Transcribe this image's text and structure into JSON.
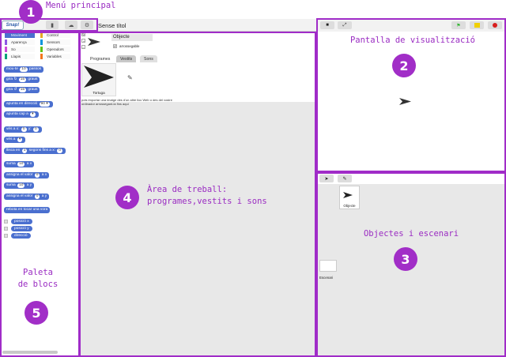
{
  "annotations": {
    "menu": {
      "number": "1",
      "label": "Menú principal"
    },
    "stage": {
      "number": "2",
      "label": "Pantalla de visualització"
    },
    "sprites": {
      "number": "3",
      "label": "Objectes i escenari"
    },
    "work": {
      "number": "4",
      "label_line1": "Àrea de treball:",
      "label_line2": "programes,vestits i sons"
    },
    "palette": {
      "number": "5",
      "label_line1": "Paleta",
      "label_line2": "de blocs"
    }
  },
  "topbar": {
    "logo": "Snap!",
    "project_title": "Sense títol",
    "icons": [
      "file-icon",
      "cloud-icon",
      "gear-icon"
    ]
  },
  "palette": {
    "categories": [
      {
        "label": "Moviment",
        "color": "#4a6fcf"
      },
      {
        "label": "Control",
        "color": "#e6a822"
      },
      {
        "label": "Aparença",
        "color": "#8f56e3"
      },
      {
        "label": "Sensors",
        "color": "#0494dc"
      },
      {
        "label": "So",
        "color": "#cf4ad9"
      },
      {
        "label": "Operadors",
        "color": "#62c213"
      },
      {
        "label": "Llapis",
        "color": "#00a178"
      },
      {
        "label": "Variables",
        "color": "#f3761d"
      }
    ],
    "blocks": {
      "move": {
        "text": "mou-te",
        "value": "10",
        "suffix": "passos"
      },
      "turn_right": {
        "text": "gira ↻",
        "value": "15",
        "suffix": "graus"
      },
      "turn_left": {
        "text": "gira ↺",
        "value": "15",
        "suffix": "graus"
      },
      "point_dir": {
        "text": "apunta en direcció",
        "value": "90 ▾"
      },
      "point_to": {
        "text": "apunta cap a",
        "value": "▾"
      },
      "goto_xy": {
        "text": "vés a x:",
        "x": "0",
        "ylabel": "y:",
        "y": "0"
      },
      "goto": {
        "text": "vés a",
        "value": "▾"
      },
      "glide": {
        "text": "llisca en",
        "value": "1",
        "suffix": "segons fins a x:",
        "x": "0"
      },
      "change_x": {
        "text": "suma",
        "value": "10",
        "suffix": "a x"
      },
      "set_x": {
        "text": "assigna el valor",
        "value": "0",
        "suffix": "a x"
      },
      "change_y": {
        "text": "suma",
        "value": "10",
        "suffix": "a y"
      },
      "set_y": {
        "text": "assigna el valor",
        "value": "0",
        "suffix": "a y"
      },
      "bounce": {
        "text": "rebota en tocar una vora"
      },
      "x_pos": {
        "text": "posició x"
      },
      "y_pos": {
        "text": "posició y"
      },
      "direction": {
        "text": "direcció"
      }
    }
  },
  "sprite": {
    "name": "Objecte",
    "draggable_label": "arrossegable",
    "tabs": [
      "Programes",
      "Vestits",
      "Sons"
    ],
    "costume_name": "Tortuga",
    "hint": "pots importar una imatge des d'un altre lloc Web o des del vostre ordinador arrossegant-la fins aquí"
  },
  "corral": {
    "sprite_label": "Objecte",
    "stage_label": "Escenari"
  },
  "colors": {
    "annotation": "#a12ec7",
    "motion": "#4a6fcf",
    "flag": "#2db52d",
    "pause": "#f0d000",
    "stop": "#d81e1e"
  }
}
